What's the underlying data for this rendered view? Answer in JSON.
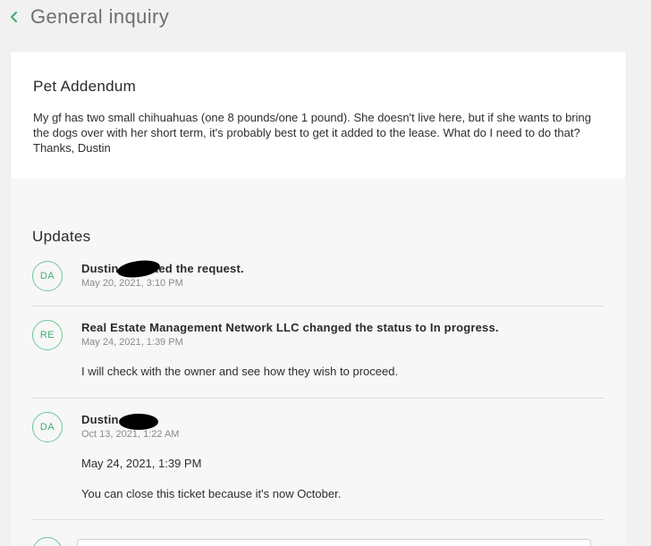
{
  "header": {
    "title": "General inquiry"
  },
  "request": {
    "title": "Pet Addendum",
    "body": "My gf has two small chihuahuas (one 8 pounds/one 1 pound). She doesn't live here, but if she wants to bring the dogs over with her short term, it's probably best to get it added to the lease. What do I need to do that? Thanks, Dustin"
  },
  "updates": {
    "heading": "Updates",
    "items": [
      {
        "avatar": "DA",
        "title": "Dustin ubmitted the request.",
        "time": "May 20, 2021, 3:10 PM",
        "messages": []
      },
      {
        "avatar": "RE",
        "title": "Real Estate Management Network LLC changed the status to In progress.",
        "time": "May 24, 2021, 1:39 PM",
        "messages": [
          "I will check with the owner and see how they wish to proceed."
        ]
      },
      {
        "avatar": "DA",
        "title": "Dustin",
        "time": "Oct 13, 2021, 1:22 AM",
        "messages": [
          "May 24, 2021, 1:39 PM",
          "You can close this ticket because it's now October."
        ]
      }
    ]
  },
  "colors": {
    "accent": "#3fae6f",
    "avatar_border": "#6cc796"
  }
}
